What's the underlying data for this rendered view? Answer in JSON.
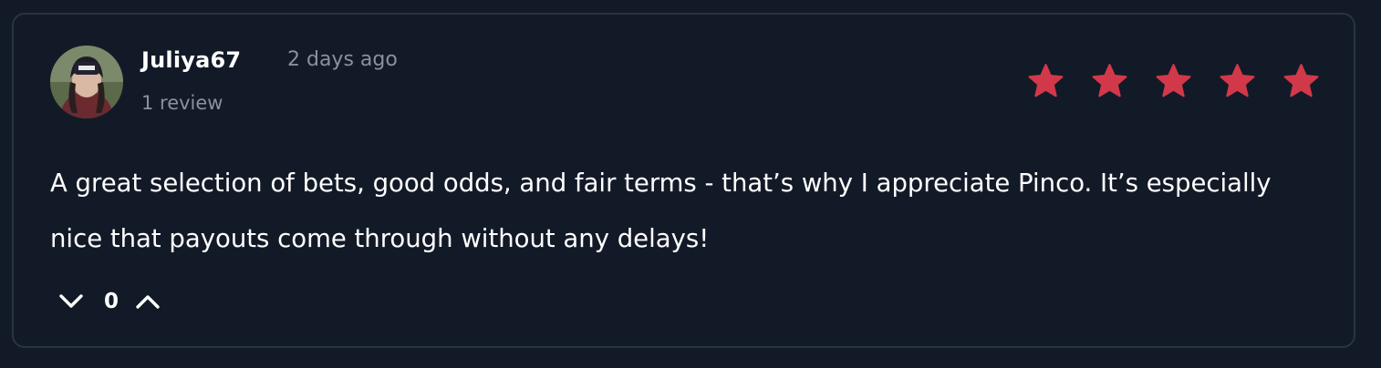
{
  "review": {
    "author": {
      "name": "Juliya67",
      "avatar_icon": "user-avatar-photo"
    },
    "timestamp": "2 days ago",
    "review_count": "1 review",
    "rating": 5,
    "rating_max": 5,
    "star_color": "#d1394a",
    "text": "A great selection of bets, good odds, and fair terms - that’s why I appreciate Pinco. It’s especially nice that payouts come through without any delays!",
    "votes": {
      "count": "0",
      "downvote_icon": "chevron-down-icon",
      "upvote_icon": "chevron-up-icon"
    }
  },
  "colors": {
    "background": "#131a27",
    "card_border": "#2a3341",
    "text_primary": "#ffffff",
    "text_muted": "#8a919c"
  }
}
